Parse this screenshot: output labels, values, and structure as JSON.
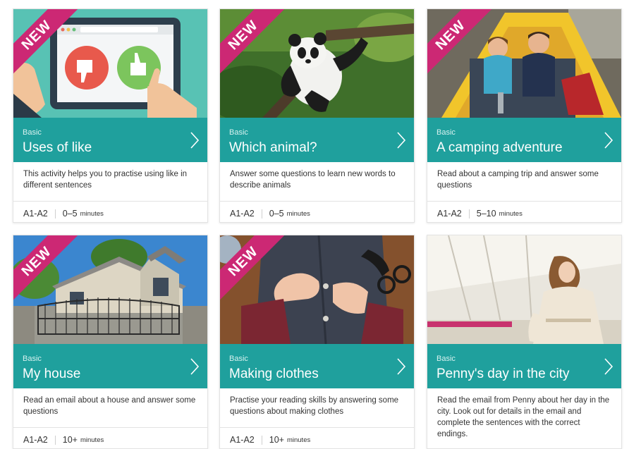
{
  "cards": [
    {
      "badge": "NEW",
      "level": "Basic",
      "title": "Uses of like",
      "description": "This activity helps you to practise using like in different sentences",
      "cefr": "A1-A2",
      "duration": "0–5",
      "duration_unit": "minutes",
      "image": "thumbs-up-tablet-illustration"
    },
    {
      "badge": "NEW",
      "level": "Basic",
      "title": "Which animal?",
      "description": "Answer some questions to learn new words to describe animals",
      "cefr": "A1-A2",
      "duration": "0–5",
      "duration_unit": "minutes",
      "image": "panda-in-tree-photo"
    },
    {
      "badge": "NEW",
      "level": "Basic",
      "title": "A camping adventure",
      "description": "Read about a camping trip and answer some questions",
      "cefr": "A1-A2",
      "duration": "5–10",
      "duration_unit": "minutes",
      "image": "couple-in-tent-photo"
    },
    {
      "badge": "NEW",
      "level": "Basic",
      "title": "My house",
      "description": "Read an email about a house and answer some questions",
      "cefr": "A1-A2",
      "duration": "10+",
      "duration_unit": "minutes",
      "image": "house-with-gate-photo"
    },
    {
      "badge": "NEW",
      "level": "Basic",
      "title": "Making clothes",
      "description": "Practise your reading skills by answering some questions about making clothes",
      "cefr": "A1-A2",
      "duration": "10+",
      "duration_unit": "minutes",
      "image": "sewing-button-photo"
    },
    {
      "badge": "",
      "level": "Basic",
      "title": "Penny's day in the city",
      "description": "Read the email from Penny about her day in the city. Look out for details in the email and complete the sentences with the correct endings.",
      "image": "woman-in-station-photo"
    }
  ],
  "colors": {
    "accent": "#1fa09d",
    "badge": "#cc2874"
  }
}
